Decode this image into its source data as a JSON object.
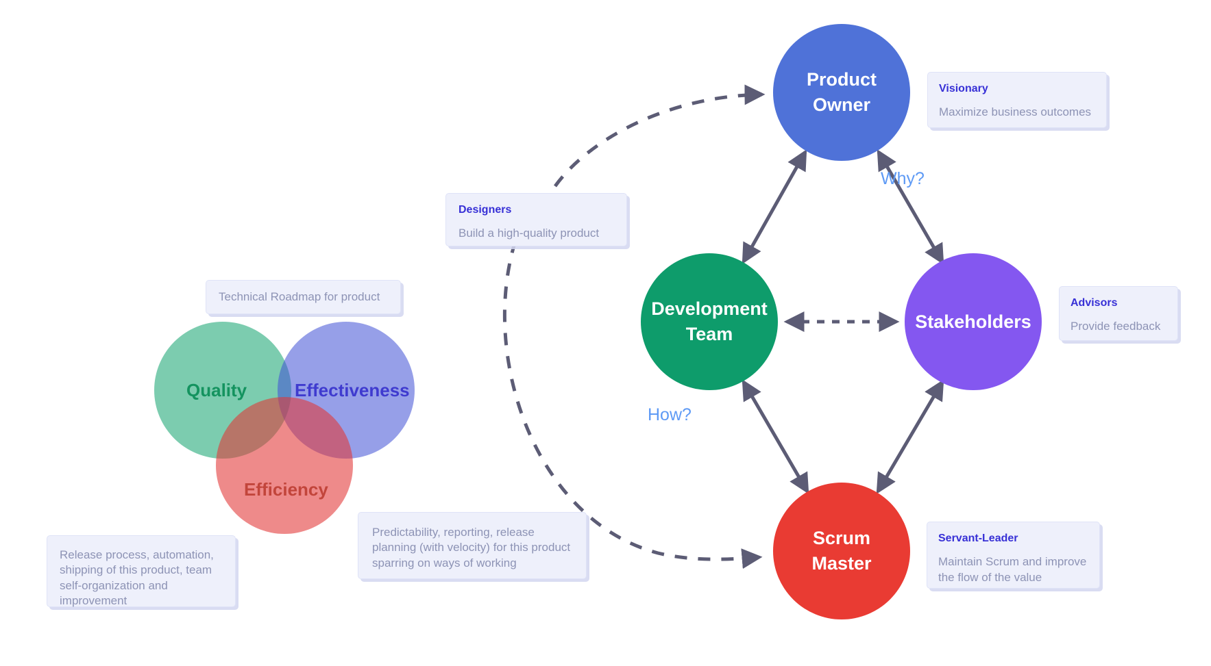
{
  "diagram": {
    "title": "Scrum roles and product quality diagram",
    "colors": {
      "product_owner": "#4f72d8",
      "development_team": "#0e9c6b",
      "stakeholders": "#8457f0",
      "scrum_master": "#e93b33",
      "callout_bg": "#eef0fb",
      "callout_title": "#3730d6",
      "callout_body": "#8d93b5",
      "question_label": "#5e9af5",
      "connector": "#5c5c75",
      "venn_quality": "#10a36d",
      "venn_effectiveness": "#3f51d6",
      "venn_efficiency": "#e23636"
    },
    "roles": [
      {
        "id": "product-owner",
        "label": "Product\nOwner",
        "color": "#4f72d8"
      },
      {
        "id": "development-team",
        "label": "Development\nTeam",
        "color": "#0e9c6b"
      },
      {
        "id": "stakeholders",
        "label": "Stakeholders",
        "color": "#8457f0"
      },
      {
        "id": "scrum-master",
        "label": "Scrum\nMaster",
        "color": "#e93b33"
      }
    ],
    "callouts": {
      "visionary": {
        "title": "Visionary",
        "body": "Maximize business outcomes"
      },
      "advisors": {
        "title": "Advisors",
        "body": "Provide feedback"
      },
      "servant_leader": {
        "title": "Servant-Leader",
        "body": "Maintain Scrum and improve the flow of the value"
      },
      "designers": {
        "title": "Designers",
        "body": "Build a high-quality product"
      },
      "technical_roadmap": {
        "body": "Technical Roadmap for product"
      },
      "release_process": {
        "body": "Release process, automation, shipping of this product, team self-organization and improvement"
      },
      "predictability": {
        "body": "Predictability, reporting, release planning (with velocity) for this product sparring on ways of working"
      }
    },
    "questions": {
      "why": "Why?",
      "how": "How?"
    },
    "venn": {
      "quality": "Quality",
      "effectiveness": "Effectiveness",
      "efficiency": "Efficiency"
    }
  }
}
